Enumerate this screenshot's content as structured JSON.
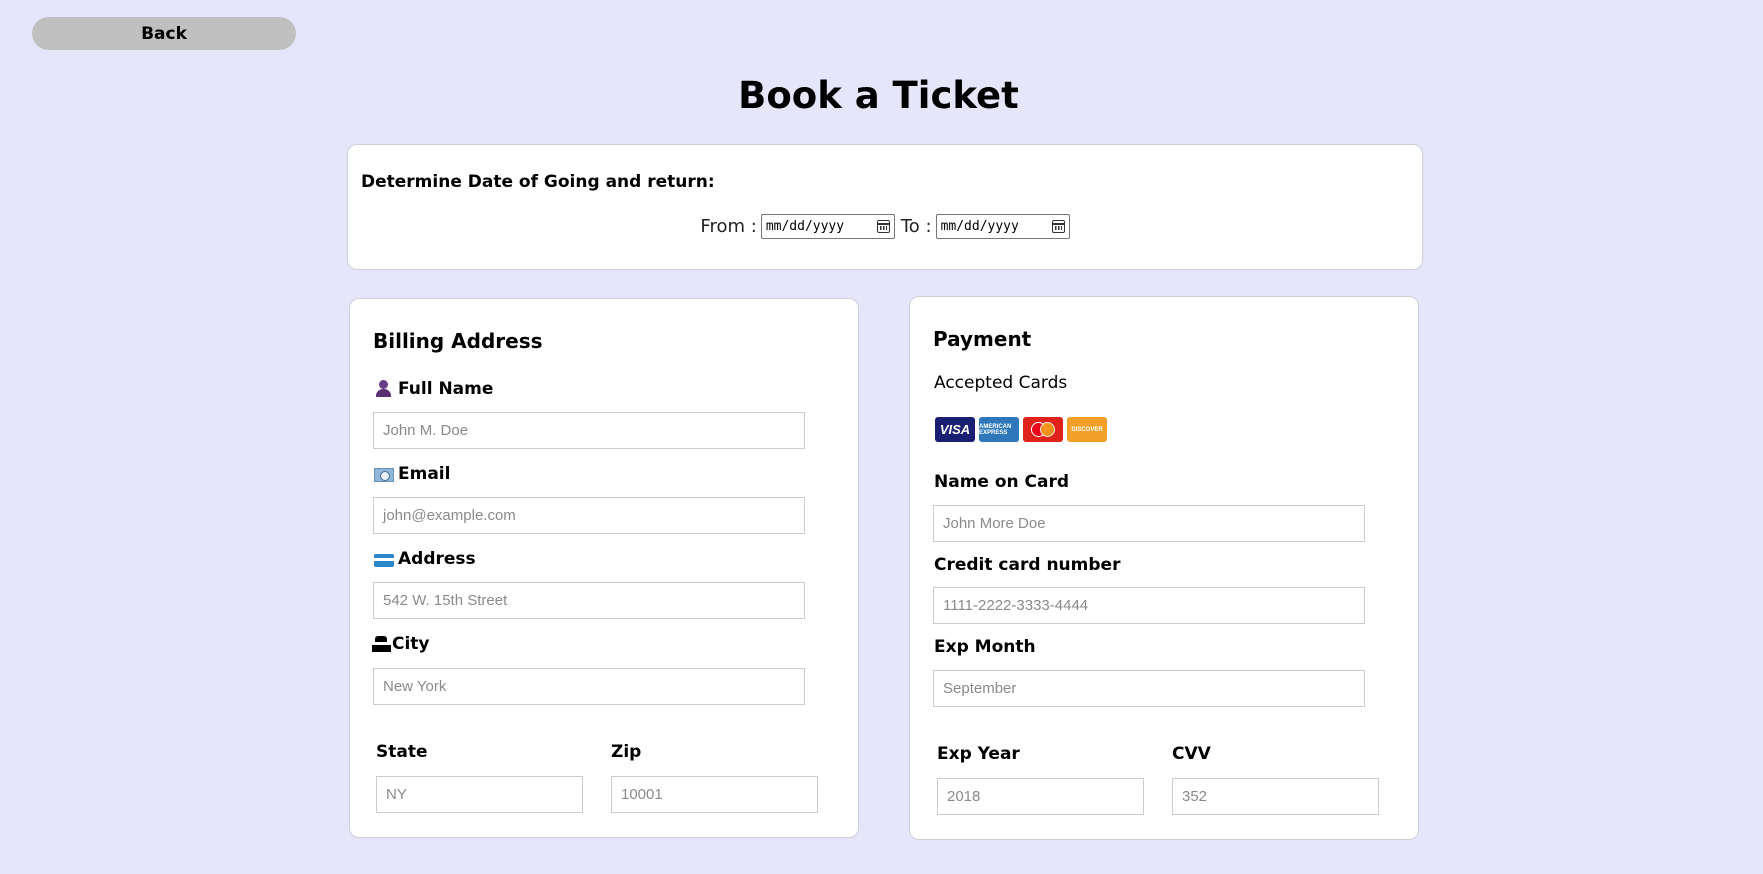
{
  "back_label": "Back",
  "title": "Book a Ticket",
  "dates": {
    "heading": "Determine Date of Going and return:",
    "from_label": "From :",
    "to_label": "To :",
    "from_value": "mm/dd/yyyy",
    "to_value": "mm/dd/yyyy"
  },
  "billing": {
    "heading": "Billing Address",
    "full_name_label": "Full Name",
    "full_name_placeholder": "John M. Doe",
    "email_label": "Email",
    "email_placeholder": "john@example.com",
    "address_label": "Address",
    "address_placeholder": "542 W. 15th Street",
    "city_label": "City",
    "city_placeholder": "New York",
    "state_label": "State",
    "state_placeholder": "NY",
    "zip_label": "Zip",
    "zip_placeholder": "10001"
  },
  "payment": {
    "heading": "Payment",
    "accepted_cards_label": "Accepted Cards",
    "cards": {
      "visa": "VISA",
      "amex": "AMERICAN EXPRESS",
      "discover": "DISCOVER"
    },
    "name_on_card_label": "Name on Card",
    "name_on_card_placeholder": "John More Doe",
    "cc_number_label": "Credit card number",
    "cc_number_placeholder": "1111-2222-3333-4444",
    "exp_month_label": "Exp Month",
    "exp_month_placeholder": "September",
    "exp_year_label": "Exp Year",
    "exp_year_placeholder": "2018",
    "cvv_label": "CVV",
    "cvv_placeholder": "352"
  },
  "icons": {
    "full_name": "person-icon",
    "email": "email-icon",
    "address": "credit-card-icon",
    "city": "building-icon",
    "calendar": "calendar-icon"
  }
}
